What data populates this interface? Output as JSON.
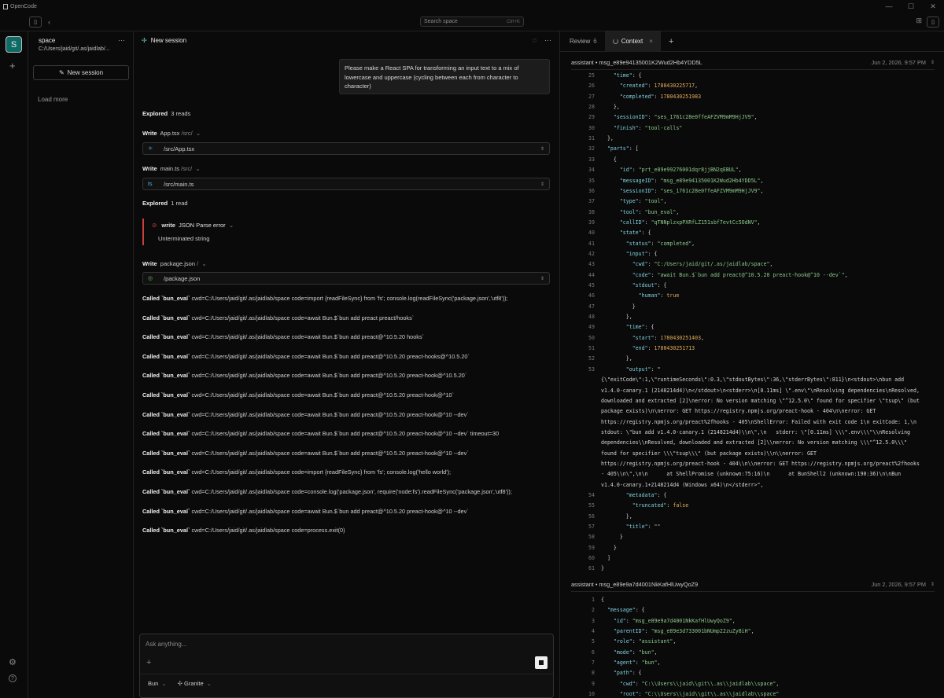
{
  "titlebar": {
    "app_name": "OpenCode",
    "controls": [
      "—",
      "☐",
      "✕"
    ]
  },
  "search": {
    "placeholder": "Search space",
    "shortcut": "Ctrl+K"
  },
  "rail": {
    "avatar": "S"
  },
  "sidebar": {
    "workspace": "space",
    "path": "C:/Users/jaid/git/.as/jaidlab/...",
    "new_session": "New session",
    "load_more": "Load more"
  },
  "chat": {
    "title": "New session",
    "user_message": "Please make a React SPA for transforming an input text to a mix of lowercase and uppercase (cycling between each from character to character)",
    "explored1": {
      "label": "Explored",
      "count": "3 reads"
    },
    "write1": {
      "label": "Write",
      "file": "App.tsx",
      "dir": "/src/",
      "path": "/src/App.tsx"
    },
    "write2": {
      "label": "Write",
      "file": "main.ts",
      "dir": "/src/",
      "path": "/src/main.ts"
    },
    "explored2": {
      "label": "Explored",
      "count": "1 read"
    },
    "error": {
      "tool": "write",
      "title": "JSON Parse error",
      "detail": "Unterminated string"
    },
    "write3": {
      "label": "Write",
      "file": "package.json",
      "dir": "/",
      "path": "/package.json"
    },
    "calls": [
      {
        "label": "Called `bun_eval`",
        "args": "cwd=C:/Users/jaid/git/.as/jaidlab/space  code=import {readFileSync} from 'fs'; console.log(readFileSync('package.json','utf8'));"
      },
      {
        "label": "Called `bun_eval`",
        "args": "cwd=C:/Users/jaid/git/.as/jaidlab/space  code=await Bun.$`bun add preact preact/hooks`"
      },
      {
        "label": "Called `bun_eval`",
        "args": "cwd=C:/Users/jaid/git/.as/jaidlab/space  code=await Bun.$`bun add preact@^10.5.20 hooks`"
      },
      {
        "label": "Called `bun_eval`",
        "args": "cwd=C:/Users/jaid/git/.as/jaidlab/space  code=await Bun.$`bun add preact@^10.5.20 preact-hooks@^10.5.20`"
      },
      {
        "label": "Called `bun_eval`",
        "args": "cwd=C:/Users/jaid/git/.as/jaidlab/space  code=await Bun.$`bun add preact@^10.5.20 preact-hook@^10.5.20`"
      },
      {
        "label": "Called `bun_eval`",
        "args": "cwd=C:/Users/jaid/git/.as/jaidlab/space  code=await Bun.$`bun add preact@^10.5.20 preact-hook@^10`"
      },
      {
        "label": "Called `bun_eval`",
        "args": "cwd=C:/Users/jaid/git/.as/jaidlab/space  code=await Bun.$`bun add preact@^10.5.20 preact-hook@^10 --dev`"
      },
      {
        "label": "Called `bun_eval`",
        "args": "cwd=C:/Users/jaid/git/.as/jaidlab/space  code=await Bun.$`bun add preact@^10.5.20 preact-hook@^10 --dev`  timeout=30"
      },
      {
        "label": "Called `bun_eval`",
        "args": "cwd=C:/Users/jaid/git/.as/jaidlab/space  code=await Bun.$`bun add preact@^10.5.20 preact-hook@^10 --dev`"
      },
      {
        "label": "Called `bun_eval`",
        "args": "cwd=C:/Users/jaid/git/.as/jaidlab/space  code=import {readFileSync} from 'fs'; console.log('hello world');"
      },
      {
        "label": "Called `bun_eval`",
        "args": "cwd=C:/Users/jaid/git/.as/jaidlab/space  code=console.log('package.json', require('node:fs').readFileSync('package.json','utf8'));"
      },
      {
        "label": "Called `bun_eval`",
        "args": "cwd=C:/Users/jaid/git/.as/jaidlab/space  code=await Bun.$`bun add preact@^10.5.20 preact-hook@^10 --dev`"
      },
      {
        "label": "Called `bun_eval`",
        "args": "cwd=C:/Users/jaid/git/.as/jaidlab/space  code=process.exit(0)"
      }
    ],
    "composer": {
      "placeholder": "Ask anything...",
      "agent": "Bun",
      "model": "Granite"
    }
  },
  "context": {
    "tabs": {
      "review": "Review",
      "review_count": "6",
      "context": "Context"
    },
    "msg1": {
      "role": "assistant",
      "id": "msg_e89e94135001K2Wud2Hb4YDD5L",
      "date": "Jun 2, 2026, 9:57 PM"
    },
    "msg2": {
      "role": "assistant",
      "id": "msg_e89e9a7d4001NkKafHlUwyQoZ9",
      "date": "Jun 2, 2026, 9:57 PM"
    },
    "block1": [
      {
        "n": "25",
        "t": "    \"time\": {"
      },
      {
        "n": "26",
        "t": "      \"created\": 1780430225717,"
      },
      {
        "n": "27",
        "t": "      \"completed\": 1780430251983"
      },
      {
        "n": "28",
        "t": "    },"
      },
      {
        "n": "29",
        "t": "    \"sessionID\": \"ses_1761c28e0ffeAFZVM9mM9HjJV9\","
      },
      {
        "n": "30",
        "t": "    \"finish\": \"tool-calls\""
      },
      {
        "n": "31",
        "t": "  },"
      },
      {
        "n": "32",
        "t": "  \"parts\": ["
      },
      {
        "n": "33",
        "t": "    {"
      },
      {
        "n": "34",
        "t": "      \"id\": \"prt_e89e99276001dqr8jjBN2qEBUL\","
      },
      {
        "n": "35",
        "t": "      \"messageID\": \"msg_e89e94135001K2Wud2Hb4YDD5L\","
      },
      {
        "n": "36",
        "t": "      \"sessionID\": \"ses_1761c28e0ffeAFZVM9mM9HjJV9\","
      },
      {
        "n": "37",
        "t": "      \"type\": \"tool\","
      },
      {
        "n": "38",
        "t": "      \"tool\": \"bun_eval\","
      },
      {
        "n": "39",
        "t": "      \"callID\": \"qTNNplzxpPXRfLZ151sbf7evtCc5OdNV\","
      },
      {
        "n": "40",
        "t": "      \"state\": {"
      },
      {
        "n": "41",
        "t": "        \"status\": \"completed\","
      },
      {
        "n": "42",
        "t": "        \"input\": {"
      },
      {
        "n": "43",
        "t": "          \"cwd\": \"C:/Users/jaid/git/.as/jaidlab/space\","
      },
      {
        "n": "44",
        "t": "          \"code\": \"await Bun.$`bun add preact@^10.5.20 preact-hook@^10 --dev`\","
      },
      {
        "n": "45",
        "t": "          \"stdout\": {"
      },
      {
        "n": "46",
        "t": "            \"human\": true"
      },
      {
        "n": "47",
        "t": "          }"
      },
      {
        "n": "48",
        "t": "        },"
      },
      {
        "n": "49",
        "t": "        \"time\": {"
      },
      {
        "n": "50",
        "t": "          \"start\": 1780430251403,"
      },
      {
        "n": "51",
        "t": "          \"end\": 1780430251713"
      },
      {
        "n": "52",
        "t": "        },"
      },
      {
        "n": "53",
        "t": "        \"output\": \""
      }
    ],
    "output_lines": [
      "{\\\"exitCode\\\":1,\\\"runtimeSeconds\\\":0.3,\\\"stdoutBytes\\\":36,\\\"stderrBytes\\\":811}\\n<stdout>\\nbun add",
      "v1.4.0-canary.1 (2148214d4)\\n</stdout>\\n<stderr>\\n[0.11ms] \\\".env\\\"\\nResolving dependencies\\nResolved,",
      "downloaded and extracted [2]\\nerror: No version matching \\\"^12.5.0\\\" found for specifier \\\"tsup\\\" (but",
      "package exists)\\n\\nerror: GET https://registry.npmjs.org/preact-hook - 404\\n\\nerror: GET",
      "https://registry.npmjs.org/preact%2fhooks - 405\\nShellError: Failed with exit code 1\\n exitCode: 1,\\n",
      "stdout: \\\"bun add v1.4.0-canary.1 (2148214d4)\\\\n\\\",\\n   stderr: \\\"[0.11ms] \\\\\\\".env\\\\\\\"\\\\nResolving",
      "dependencies\\\\nResolved, downloaded and extracted [2]\\\\nerror: No version matching \\\\\\\"^12.5.0\\\\\\\"",
      "found for specifier \\\\\\\"tsup\\\\\\\" (but package exists)\\\\n\\\\nerror: GET",
      "https://registry.npmjs.org/preact-hook - 404\\\\n\\\\nerror: GET https://registry.npmjs.org/preact%2fhooks",
      "- 405\\\\n\\\",\\n\\n      at ShellPromise (unknown:75:16)\\n      at BunShell2 (unknown:190:36)\\n\\nBun",
      "v1.4.0-canary.1+2148214d4 (Windows x64)\\n</stderr>\","
    ],
    "block1_tail": [
      {
        "n": "54",
        "t": "        \"metadata\": {"
      },
      {
        "n": "55",
        "t": "          \"truncated\": false"
      },
      {
        "n": "56",
        "t": "        },"
      },
      {
        "n": "57",
        "t": "        \"title\": \"\""
      },
      {
        "n": "58",
        "t": "      }"
      },
      {
        "n": "59",
        "t": "    }"
      },
      {
        "n": "60",
        "t": "  ]"
      },
      {
        "n": "61",
        "t": "}"
      }
    ],
    "block2": [
      {
        "n": "1",
        "t": "{"
      },
      {
        "n": "2",
        "t": "  \"message\": {"
      },
      {
        "n": "3",
        "t": "    \"id\": \"msg_e89e9a7d4001NkKafHlUwyQoZ9\","
      },
      {
        "n": "4",
        "t": "    \"parentID\": \"msg_e89e3d733001bNUmp22zuZy8iH\","
      },
      {
        "n": "5",
        "t": "    \"role\": \"assistant\","
      },
      {
        "n": "6",
        "t": "    \"mode\": \"bun\","
      },
      {
        "n": "7",
        "t": "    \"agent\": \"bun\","
      },
      {
        "n": "8",
        "t": "    \"path\": {"
      },
      {
        "n": "9",
        "t": "      \"cwd\": \"C:\\\\Users\\\\jaid\\\\git\\\\.as\\\\jaidlab\\\\space\","
      },
      {
        "n": "10",
        "t": "      \"root\": \"C:\\\\Users\\\\jaid\\\\git\\\\.as\\\\jaidlab\\\\space\""
      }
    ]
  }
}
